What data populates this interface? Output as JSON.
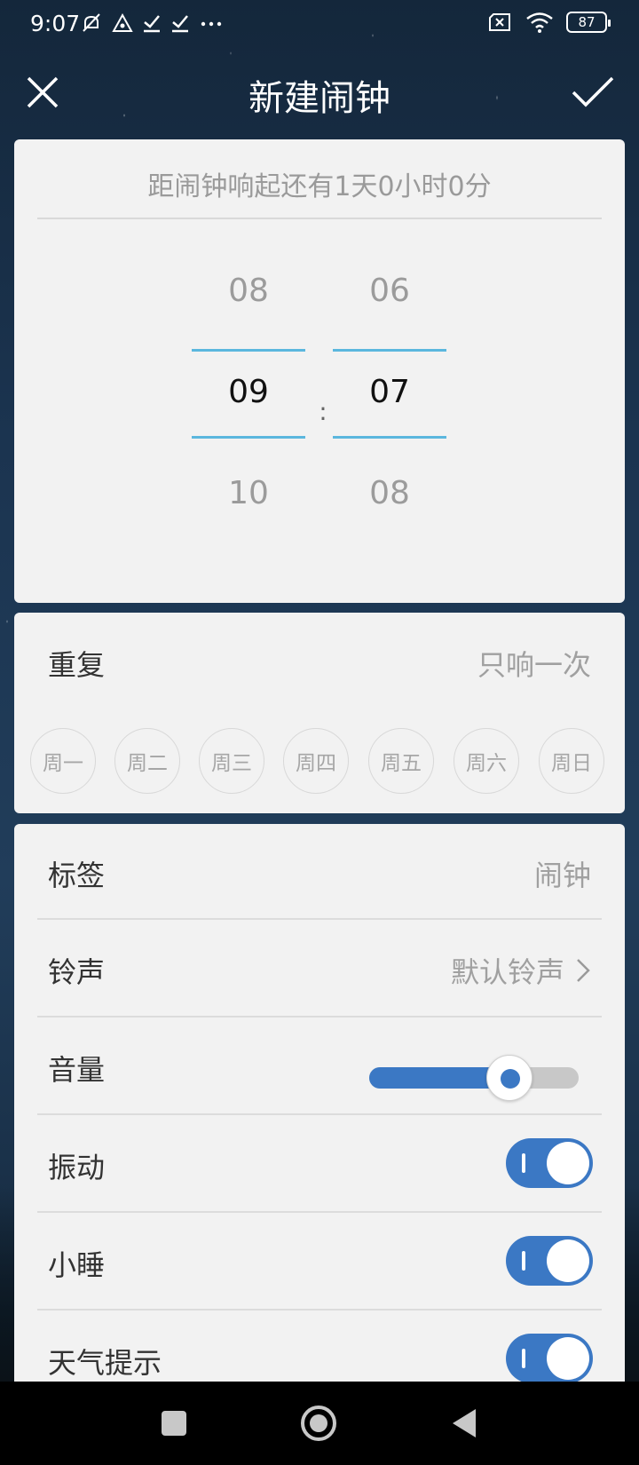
{
  "status_bar": {
    "time": "9:07",
    "left_icons": [
      "muted-bell-icon",
      "triangle-icon",
      "check-icon",
      "check-icon",
      "more-dots-icon"
    ],
    "battery": "87"
  },
  "header": {
    "title": "新建闹钟"
  },
  "time_picker": {
    "countdown": "距闹钟响起还有1天0小时0分",
    "hours": {
      "prev": "08",
      "selected": "09",
      "next": "10"
    },
    "minutes": {
      "prev": "06",
      "selected": "07",
      "next": "08"
    },
    "separator": ":"
  },
  "repeat": {
    "label": "重复",
    "value": "只响一次",
    "days": [
      "周一",
      "周二",
      "周三",
      "周四",
      "周五",
      "周六",
      "周日"
    ]
  },
  "settings": {
    "label_row": {
      "label": "标签",
      "value": "闹钟"
    },
    "ringtone_row": {
      "label": "铃声",
      "value": "默认铃声"
    },
    "volume_row": {
      "label": "音量",
      "level": 0.67
    },
    "vibrate_row": {
      "label": "振动",
      "on": true
    },
    "snooze_row": {
      "label": "小睡",
      "on": true
    },
    "weather_row": {
      "label": "天气提示",
      "on": true
    }
  },
  "colors": {
    "accent": "#3b78c4",
    "picker_line": "#5bb7de",
    "card_bg": "#f2f2f2"
  }
}
